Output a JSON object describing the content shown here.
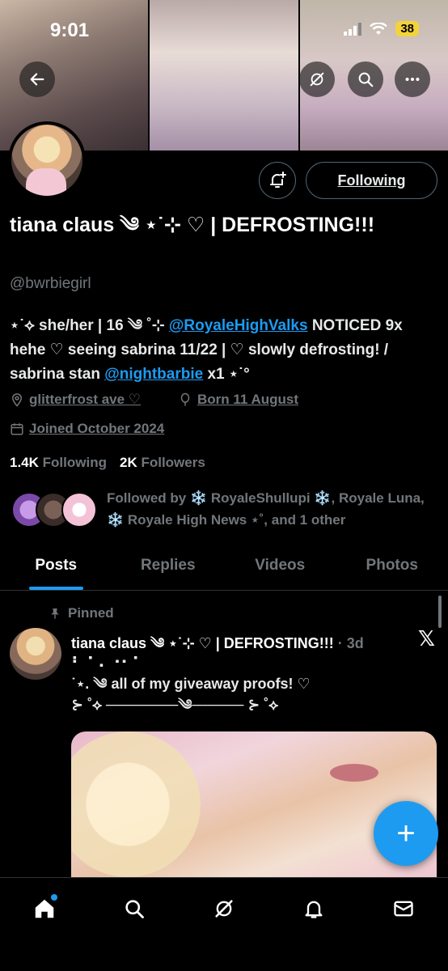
{
  "status_bar": {
    "time": "9:01",
    "battery": "38"
  },
  "profile": {
    "name": "tiana claus ༄ ⋆˙⊹ ♡ | DEFROSTING!!!",
    "handle": "@bwrbiegirl",
    "following_button": "Following",
    "bio_part1": "⋆˙⟡ she/her | 16 ༄ ˚⊹ ",
    "bio_mention1": "@RoyaleHighValks",
    "bio_part2": " NOTICED 9x hehe ♡ seeing sabrina 11/22 | ♡ slowly defrosting! / sabrina stan ",
    "bio_mention2": "@nightbarbie",
    "bio_part3": " x1 ⋆˙°",
    "location": "glitterfrost ave ♡",
    "birthday": "Born 11 August",
    "joined": "Joined October 2024",
    "following_count": "1.4K",
    "following_label": "Following",
    "followers_count": "2K",
    "followers_label": "Followers",
    "followed_by": "Followed by ❄️ RoyaleShullupi ❄️, Royale Luna, ❄️ Royale High News ⋆˚, and 1 other"
  },
  "tabs": [
    {
      "label": "Posts",
      "active": true
    },
    {
      "label": "Replies",
      "active": false
    },
    {
      "label": "Videos",
      "active": false
    },
    {
      "label": "Photos",
      "active": false
    }
  ],
  "post": {
    "pinned_label": "Pinned",
    "author": "tiana claus ༄ ⋆˙⊹ ♡ | DEFROSTING!!!",
    "time": "· 3d",
    "line1": "⠃⠈ ⠄⠐⠂⠁",
    "line2": "˙⋆. ༄ all of my giveaway proofs! ♡",
    "line3": "⊱ ˚⟡ ───────༄───── ⊱ ˚⟡"
  },
  "fab_label": "+",
  "colors": {
    "accent": "#1d9bf0",
    "background": "#000000",
    "muted": "#71767b"
  }
}
